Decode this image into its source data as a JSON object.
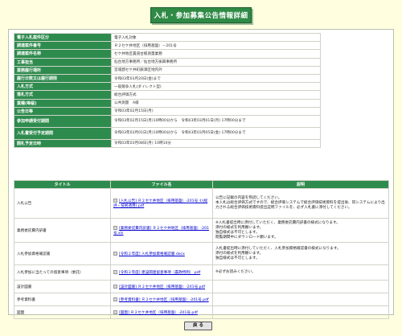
{
  "page_title": "入札・参加募集公告情報詳細",
  "info_rows": [
    {
      "label": "電子入札案件区分",
      "value": "電子入札対象"
    },
    {
      "label": "調達案件番号",
      "value": "Ｒ２セケ井地区（排用基盤）－201号"
    },
    {
      "label": "調達案件名称",
      "value": "セケ井地区農道台帳測量業務"
    },
    {
      "label": "工事担当",
      "value": "仙台地方事務所／仙台地方振興事務所"
    },
    {
      "label": "業務履行場所",
      "value": "宮城郡セケ井町蕨澤区地内外"
    },
    {
      "label": "履行日数又は履行期限",
      "value": "令和03年03月20日(金)まで"
    },
    {
      "label": "入札方式",
      "value": "一般競争入札(ダイレクト型)"
    },
    {
      "label": "落札方式",
      "value": "総合評価方式"
    },
    {
      "label": "業種(等級)",
      "value": "公共測量　A级"
    },
    {
      "label": "公告日等",
      "value": "令和03年02月15日(月)"
    },
    {
      "label": "参加申請受付期間",
      "value": "令和03年02月15日(月)10時00分から　令和03年03月01日(月) 17時00分まで"
    },
    {
      "label": "入札書受付予定期間",
      "value": "令和03年03月01日(月)10時00分から　令和03年03月05日(金) 17時00分まで"
    },
    {
      "label": "開札予定日時",
      "value": "令和03年03月08日(月) 10時10分"
    }
  ],
  "docs_headers": {
    "title": "タイトル",
    "file": "ファイル名",
    "desc": "説明"
  },
  "docs": [
    {
      "title": "入札公告",
      "file": "[入札公告] Ｒ２セケ井地区（排用基盤）-201号 ①(総評・技術適用).pdf",
      "desc": [
        "公告に記載の内容を熟読してください。",
        "本入札は総合評価方式ですので、総合評価システムで総合評価技術資料を提出後、同システムにより出力される総合評価技術資料提出証明ファイルを、必ず入札書に添付してください。"
      ]
    },
    {
      "title": "業務委託費内訳書",
      "file": "[業務委託費内訳書] Ｒ２セケ井地区（排用基盤）-201号.xls",
      "desc": [
        "※入札書提出時に添付していただく、業務委託費内訳書の様式になります。",
        "添付の様式を利用願います。",
        "独自様式は不可とします。",
        "閲覧期間中にダウンロード願います。"
      ]
    },
    {
      "title": "入札参加資格確認書",
      "file": "[令和２年度] 入札参加資格確認書.docx",
      "desc": [
        "入札書提出時に添付していただく、入札参加資格確認書の様式になります。",
        "添付の様式を利用願います。",
        "独自様式は不可とします。"
      ]
    },
    {
      "title": "入札参加に当たっての留意事項（委託）",
      "file": "[令和２年度] 建設関連留意事項（農政特例）.pdf",
      "desc": [
        "※必ずお読みください。"
      ]
    },
    {
      "title": "設計図書",
      "file": "[設計図書] Ｒ２セケ井地区（排用基盤）-201号.pdf",
      "desc": [
        ""
      ]
    },
    {
      "title": "参考資料書",
      "file": "[参考資料書] Ｒ２セケ井地区（排用基盤）-201号.pdf",
      "desc": [
        ""
      ]
    },
    {
      "title": "図面",
      "file": "[図面] Ｒ２セケ井地区（排用基盤）-201号.pdf",
      "desc": [
        ""
      ]
    }
  ],
  "back_label": "戻 る"
}
